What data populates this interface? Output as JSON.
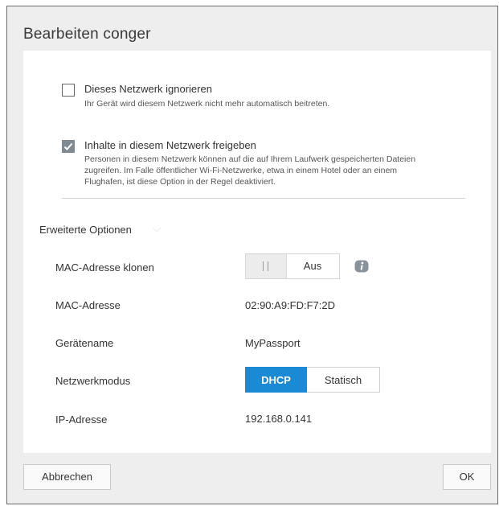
{
  "dialog": {
    "title": "Bearbeiten conger"
  },
  "options": [
    {
      "label": "Dieses Netzwerk ignorieren",
      "description": [
        "Ihr Gerät wird diesem Netzwerk nicht mehr automatisch beitreten."
      ],
      "checked": false
    },
    {
      "label": "Inhalte in diesem Netzwerk freigeben",
      "description": [
        "Personen in diesem Netzwerk können auf die auf Ihrem Laufwerk gespeicherten Dateien",
        "zugreifen. Im Falle öffentlicher Wi-Fi-Netzwerke, etwa in einem Hotel oder an einem",
        "Flughafen, ist diese Option in der Regel deaktiviert."
      ],
      "checked": true
    }
  ],
  "advanced": {
    "title": "Erweiterte Optionen",
    "mac_clone": {
      "label": "MAC-Adresse klonen",
      "state": "Aus",
      "enabled": false,
      "info_icon": "info-icon"
    },
    "mac_address": {
      "label": "MAC-Adresse",
      "value": "02:90:A9:FD:F7:2D"
    },
    "device_name": {
      "label": "Gerätename",
      "value": "MyPassport"
    },
    "network_mode": {
      "label": "Netzwerkmodus",
      "options": [
        "DHCP",
        "Statisch"
      ],
      "selected": "DHCP"
    },
    "ip_address": {
      "label": "IP-Adresse",
      "value": "192.168.0.141"
    }
  },
  "footer": {
    "cancel_label": "Abbrechen",
    "ok_label": "OK"
  },
  "colors": {
    "accent": "#1a8ad4",
    "checkbox_checked": "#7f8a93",
    "dialog_bg": "#eeeeee",
    "panel_bg": "#ffffff"
  }
}
